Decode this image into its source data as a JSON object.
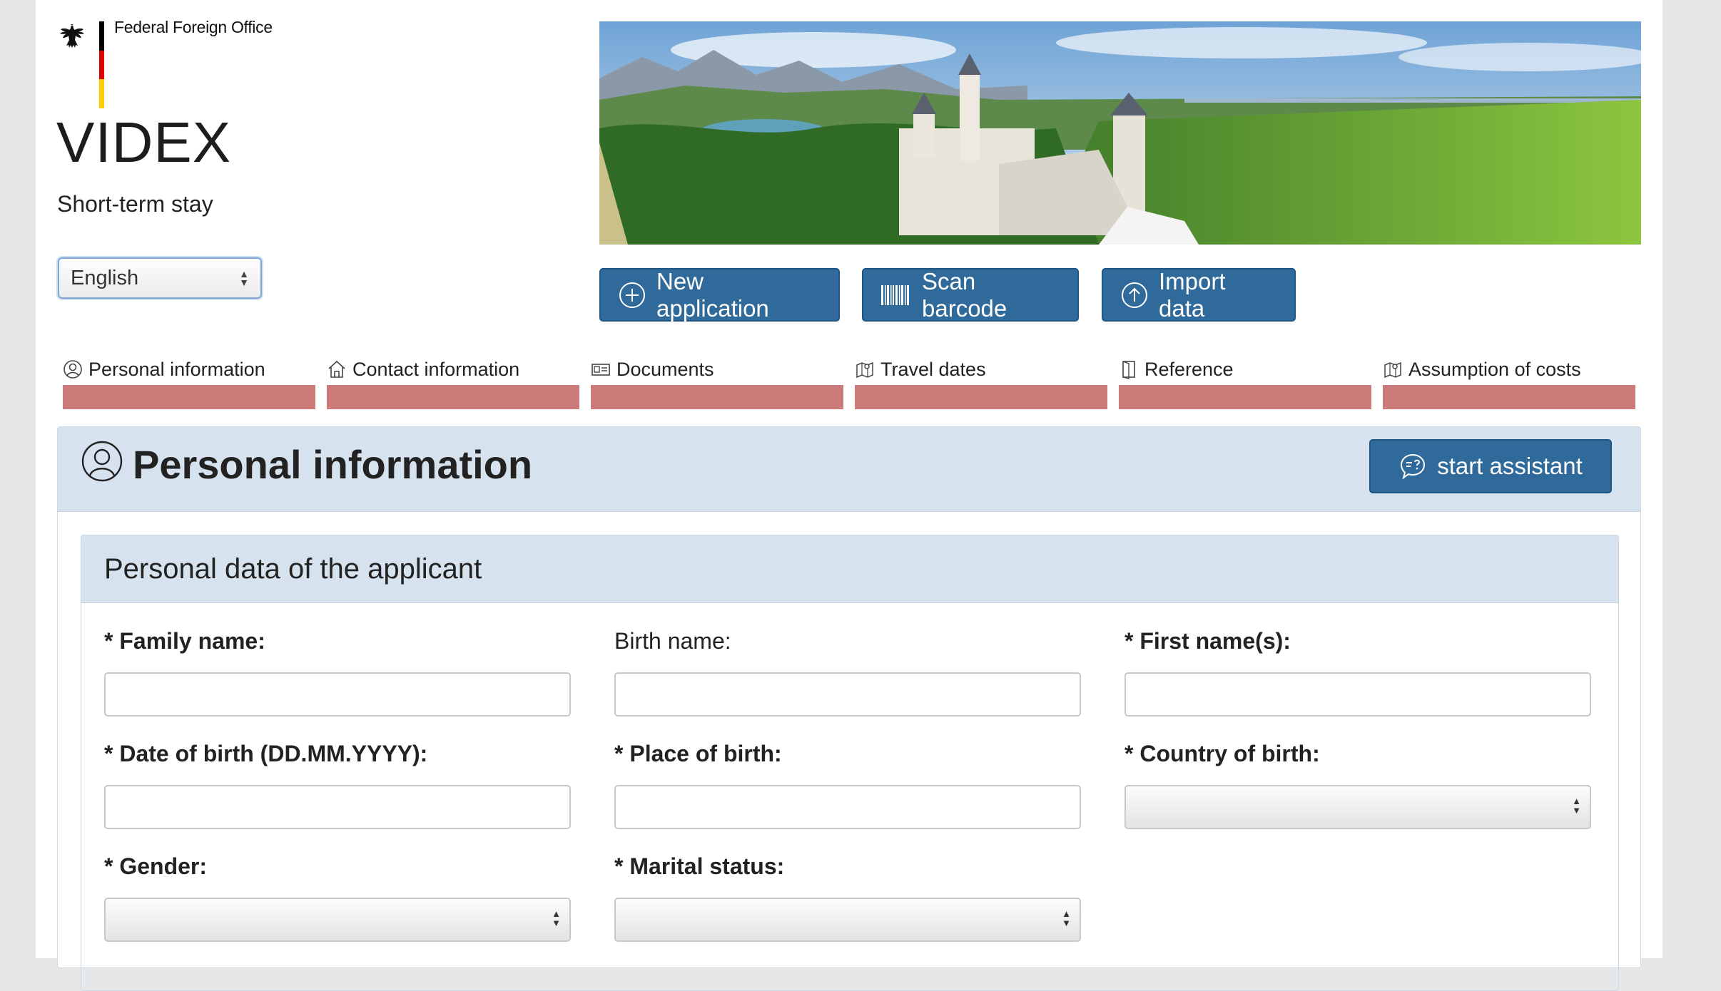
{
  "header": {
    "office": "Federal Foreign Office",
    "app_title": "VIDEX",
    "subtitle": "Short-term stay",
    "language": {
      "selected": "English"
    },
    "flag_colors": [
      "#000000",
      "#dd0000",
      "#ffce00"
    ]
  },
  "actions": {
    "new_application": "New application",
    "scan_barcode": "Scan barcode",
    "import_data": "Import data"
  },
  "steps": [
    {
      "label": "Personal information",
      "icon": "person-icon"
    },
    {
      "label": "Contact information",
      "icon": "house-icon"
    },
    {
      "label": "Documents",
      "icon": "id-card-icon"
    },
    {
      "label": "Travel dates",
      "icon": "map-pin-icon"
    },
    {
      "label": "Reference",
      "icon": "door-icon"
    },
    {
      "label": "Assumption of costs",
      "icon": "map-pin-icon"
    }
  ],
  "section": {
    "title": "Personal information",
    "assistant_button": "start assistant",
    "panel_title": "Personal data of the applicant",
    "fields": {
      "family_name": "* Family name:",
      "birth_name": "Birth name:",
      "first_names": "* First name(s):",
      "date_of_birth": "* Date of birth (DD.MM.YYYY):",
      "place_of_birth": "* Place of birth:",
      "country_of_birth": "* Country of birth:",
      "gender": "* Gender:",
      "marital_status": "* Marital status:"
    }
  },
  "colors": {
    "primary_button": "#2f6a9b",
    "step_bar_incomplete": "#cd7a7a",
    "section_header": "#d6e3ee"
  }
}
